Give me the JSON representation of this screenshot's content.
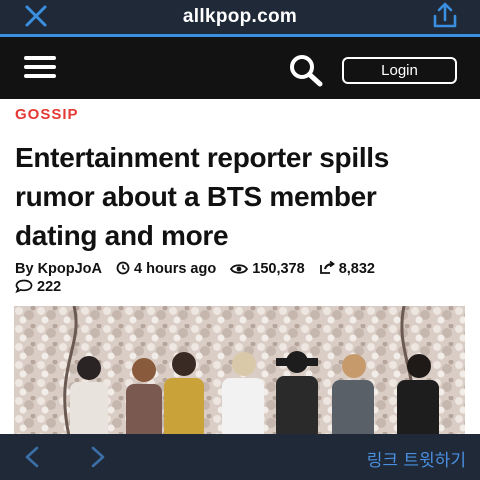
{
  "browser": {
    "url": "allkpop.com",
    "close_icon": "close-icon",
    "share_icon": "share-icon",
    "accent": "#3b8fe0"
  },
  "header": {
    "menu_icon": "hamburger-menu-icon",
    "search_icon": "search-icon",
    "login_label": "Login"
  },
  "article": {
    "category": "GOSSIP",
    "category_color": "#e53935",
    "title": "Entertainment reporter spills rumor about a BTS member dating and more",
    "author": "By KpopJoA",
    "time": "4 hours ago",
    "views": "150,378",
    "shares": "8,832",
    "comments": "222"
  },
  "bottom_toolbar": {
    "back_icon": "back-arrow-icon",
    "forward_icon": "forward-arrow-icon",
    "tweet_label": "링크 트윗하기"
  }
}
